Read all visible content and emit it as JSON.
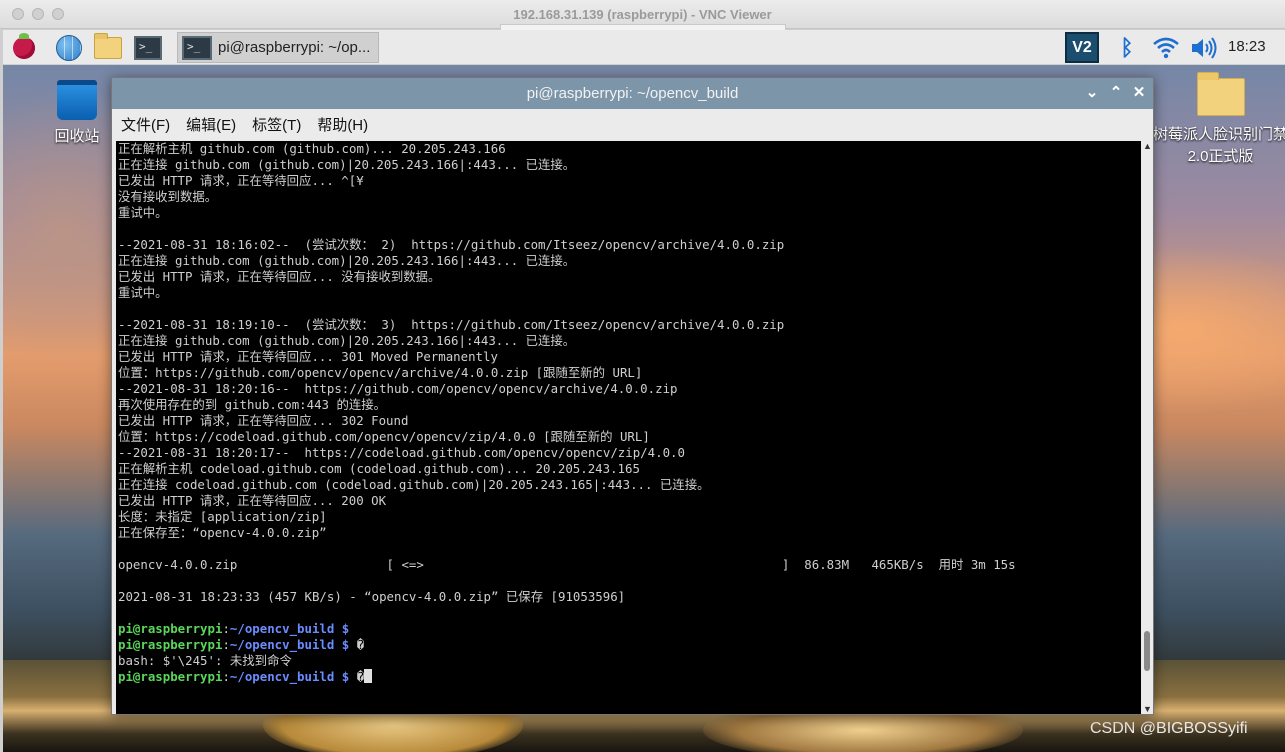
{
  "vnc_window": {
    "title": "192.168.31.139 (raspberrypi) - VNC Viewer"
  },
  "taskbar": {
    "task_label": "pi@raspberrypi: ~/op...",
    "tray_vnc": "V2",
    "clock": "18:23"
  },
  "desktop": {
    "trash_label": "回收站",
    "folder_label": "树莓派人脸识别门禁2.0正式版"
  },
  "terminal": {
    "title": "pi@raspberrypi: ~/opencv_build",
    "menu": [
      "文件(F)",
      "编辑(E)",
      "标签(T)",
      "帮助(H)"
    ],
    "lines": [
      "正在解析主机 github.com (github.com)... 20.205.243.166",
      "正在连接 github.com (github.com)|20.205.243.166|:443... 已连接。",
      "已发出 HTTP 请求，正在等待回应... ^[¥",
      "没有接收到数据。",
      "重试中。",
      "",
      "--2021-08-31 18:16:02--  (尝试次数： 2)  https://github.com/Itseez/opencv/archive/4.0.0.zip",
      "正在连接 github.com (github.com)|20.205.243.166|:443... 已连接。",
      "已发出 HTTP 请求，正在等待回应... 没有接收到数据。",
      "重试中。",
      "",
      "--2021-08-31 18:19:10--  (尝试次数： 3)  https://github.com/Itseez/opencv/archive/4.0.0.zip",
      "正在连接 github.com (github.com)|20.205.243.166|:443... 已连接。",
      "已发出 HTTP 请求，正在等待回应... 301 Moved Permanently",
      "位置：https://github.com/opencv/opencv/archive/4.0.0.zip [跟随至新的 URL]",
      "--2021-08-31 18:20:16--  https://github.com/opencv/opencv/archive/4.0.0.zip",
      "再次使用存在的到 github.com:443 的连接。",
      "已发出 HTTP 请求，正在等待回应... 302 Found",
      "位置：https://codeload.github.com/opencv/opencv/zip/4.0.0 [跟随至新的 URL]",
      "--2021-08-31 18:20:17--  https://codeload.github.com/opencv/opencv/zip/4.0.0",
      "正在解析主机 codeload.github.com (codeload.github.com)... 20.205.243.165",
      "正在连接 codeload.github.com (codeload.github.com)|20.205.243.165|:443... 已连接。",
      "已发出 HTTP 请求，正在等待回应... 200 OK",
      "长度：未指定 [application/zip]",
      "正在保存至：“opencv-4.0.0.zip”",
      "",
      "opencv-4.0.0.zip                    [ <=>                                                ]  86.83M   465KB/s  用时 3m 15s",
      "",
      "2021-08-31 18:23:33 (457 KB/s) - “opencv-4.0.0.zip” 已保存 [91053596]",
      ""
    ],
    "prompt": {
      "user": "pi@raspberrypi",
      "sep": ":",
      "path": "~/opencv_build $"
    },
    "prompt1_tail": "",
    "prompt2_tail": " �",
    "error_line": "bash: $'\\245': 未找到命令",
    "prompt3_tail": " �"
  },
  "watermark": "CSDN @BIGBOSSyifi"
}
